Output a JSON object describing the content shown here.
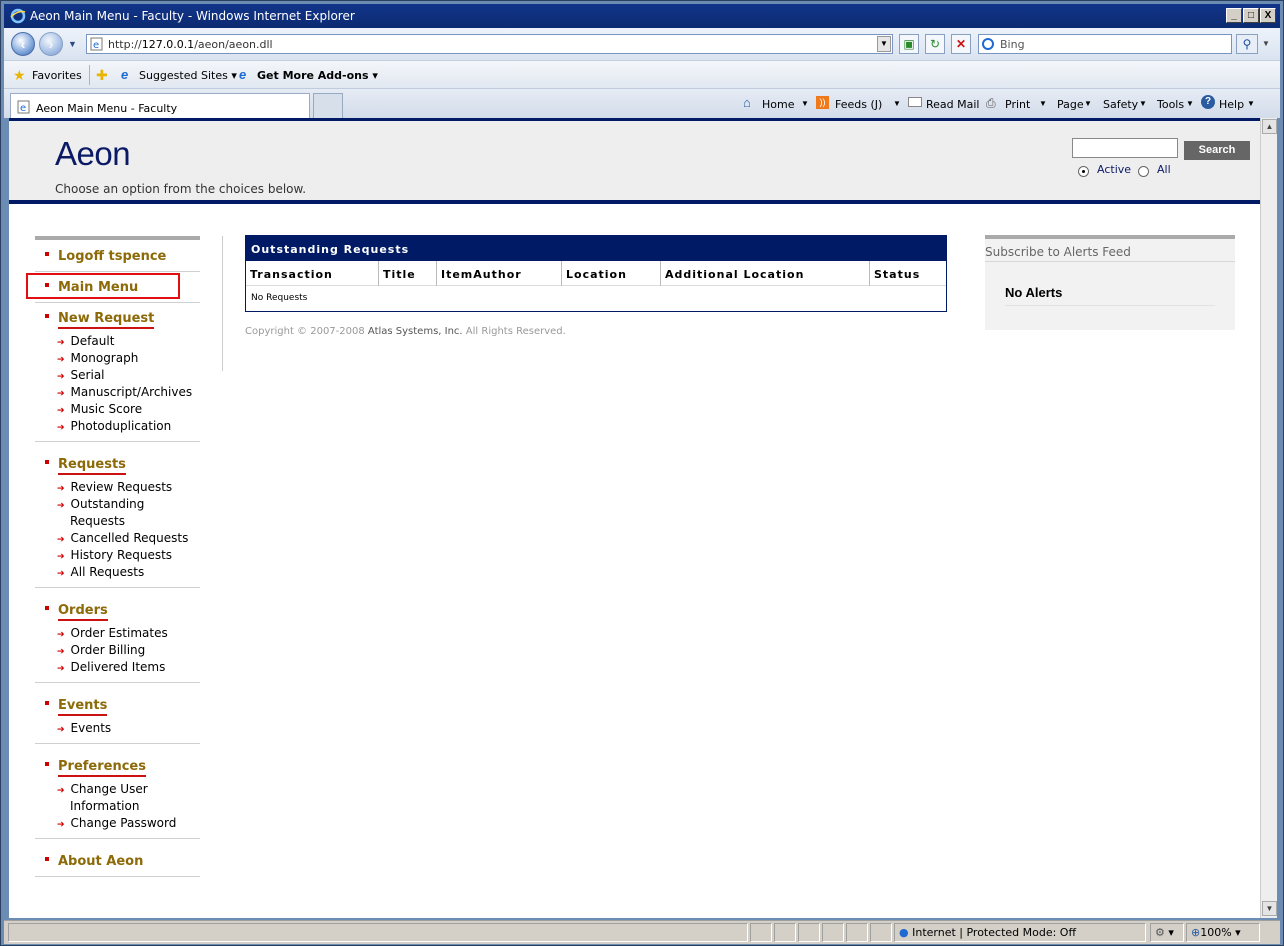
{
  "window": {
    "title": "Aeon Main Menu - Faculty - Windows Internet Explorer",
    "min_glyph": "_",
    "max_glyph": "□",
    "close_glyph": "X"
  },
  "nav": {
    "url_prefix": "http://",
    "url_host": "127.0.0.1",
    "url_path": "/aeon/aeon.dll",
    "search_placeholder": "Bing"
  },
  "favorites_bar": {
    "favorites_label": "Favorites",
    "suggested_sites_label": "Suggested Sites",
    "addons_label": "Get More Add-ons"
  },
  "tab": {
    "label": "Aeon Main Menu - Faculty"
  },
  "command_bar": {
    "home": "Home",
    "feeds": "Feeds (J)",
    "read_mail": "Read Mail",
    "print": "Print",
    "page": "Page",
    "safety": "Safety",
    "tools": "Tools",
    "help": "Help"
  },
  "aeon_header": {
    "brand": "Aeon",
    "subtitle": "Choose an option from the choices below.",
    "search_button": "Search",
    "radio_active": "Active",
    "radio_all": "All"
  },
  "left_nav": {
    "logoff": "Logoff tspence",
    "main_menu": "Main Menu",
    "new_request": {
      "head": "New Request",
      "items": [
        "Default",
        "Monograph",
        "Serial",
        "Manuscript/Archives",
        "Music Score",
        "Photoduplication"
      ]
    },
    "requests": {
      "head": "Requests",
      "items": [
        "Review Requests",
        "Outstanding",
        "Requests",
        "Cancelled Requests",
        "History Requests",
        "All Requests"
      ]
    },
    "orders": {
      "head": "Orders",
      "items": [
        "Order Estimates",
        "Order Billing",
        "Delivered Items"
      ]
    },
    "events": {
      "head": "Events",
      "items": [
        "Events"
      ]
    },
    "preferences": {
      "head": "Preferences",
      "items": [
        "Change User",
        "Information",
        "Change Password"
      ]
    },
    "about": "About Aeon"
  },
  "requests_table": {
    "caption": "Outstanding Requests",
    "columns": [
      "Transaction",
      "Title",
      "ItemAuthor",
      "Location",
      "Additional Location",
      "Status"
    ],
    "empty_text": "No Requests"
  },
  "footer": {
    "copyright_prefix": "Copyright © 2007-2008 ",
    "company": "Atlas Systems, Inc.",
    "rights": " All Rights Reserved."
  },
  "alerts": {
    "feed_label": "Subscribe to Alerts Feed",
    "empty_text": "No Alerts"
  },
  "status_bar": {
    "zone": "Internet | Protected Mode: Off",
    "zoom": "100%"
  }
}
